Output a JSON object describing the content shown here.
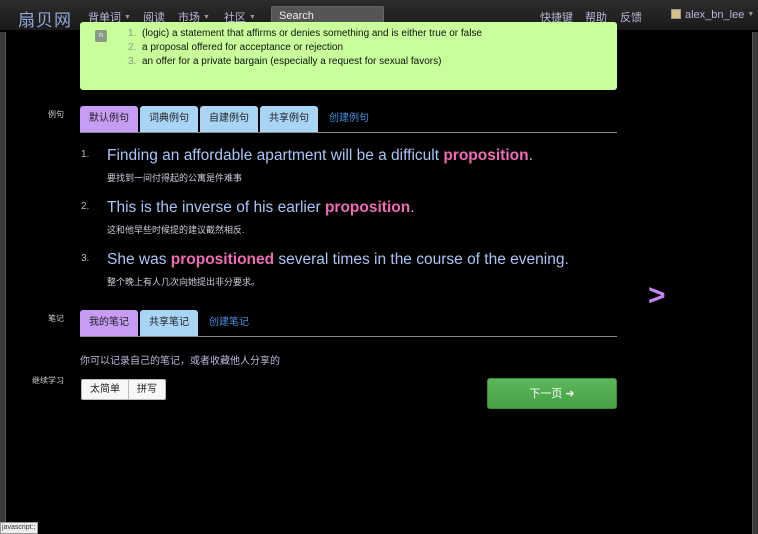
{
  "header": {
    "logo": "扇贝网",
    "nav": [
      {
        "label": "背单词",
        "caret": true
      },
      {
        "label": "阅读",
        "caret": false
      },
      {
        "label": "市场",
        "caret": true
      },
      {
        "label": "社区",
        "caret": true
      }
    ],
    "search_placeholder": "Search",
    "right": [
      "快捷键",
      "帮助",
      "反馈"
    ],
    "user": "alex_bn_lee"
  },
  "definition": {
    "badge": "n",
    "items": [
      {
        "num": "1.",
        "text": "(logic) a statement that affirms or denies something and is either true or false"
      },
      {
        "num": "2.",
        "text": "a proposal offered for acceptance or rejection"
      },
      {
        "num": "3.",
        "text": "an offer for a private bargain (especially a request for sexual favors)"
      }
    ]
  },
  "examples": {
    "label": "例句",
    "tabs": [
      "默认例句",
      "词典例句",
      "自建例句",
      "共享例句"
    ],
    "create_link": "创建例句",
    "items": [
      {
        "num": "1.",
        "before": "Finding an affordable apartment will be a difficult ",
        "highlight": "proposition",
        "after": ".",
        "zh": "要找到一间付得起的公寓是件难事"
      },
      {
        "num": "2.",
        "before": "This is the inverse of his earlier ",
        "highlight": "proposition",
        "after": ".",
        "zh": "这和他早些时候提的建议截然相反."
      },
      {
        "num": "3.",
        "before": "She was ",
        "highlight": "propositioned",
        "after": " several times in the course of the evening.",
        "zh": "整个晚上有人几次向她提出非分要求。"
      }
    ]
  },
  "notes": {
    "label": "笔记",
    "tabs": [
      "我的笔记",
      "共享笔记"
    ],
    "create_link": "创建笔记",
    "text": "你可以记录自己的笔记，或者收藏他人分享的"
  },
  "continue": {
    "label": "继续学习",
    "buttons": [
      "太简单",
      "拼写"
    ],
    "next_label": "下一页 ➜"
  },
  "next_arrow": ">",
  "status_bar": "javascript:;",
  "colors": {
    "accent_purple": "#c79cf5",
    "tab_blue": "#a8d4f6",
    "highlight": "#f06bb6",
    "def_green": "#c8ff9a",
    "next_green": "#5cb85c"
  }
}
